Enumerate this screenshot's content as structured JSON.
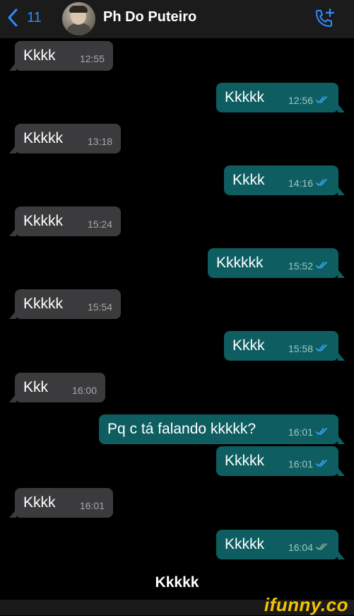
{
  "header": {
    "back_count": "11",
    "contact_name": "Ph Do Puteiro"
  },
  "messages": [
    {
      "dir": "in",
      "text": "Kkkk",
      "time": "12:55"
    },
    {
      "dir": "out",
      "text": "Kkkkk",
      "time": "12:56",
      "read": true
    },
    {
      "dir": "in",
      "text": "Kkkkk",
      "time": "13:18"
    },
    {
      "dir": "out",
      "text": "Kkkk",
      "time": "14:16",
      "read": true
    },
    {
      "dir": "in",
      "text": "Kkkkk",
      "time": "15:24"
    },
    {
      "dir": "out",
      "text": "Kkkkkk",
      "time": "15:52",
      "read": true
    },
    {
      "dir": "in",
      "text": "Kkkkk",
      "time": "15:54"
    },
    {
      "dir": "out",
      "text": "Kkkk",
      "time": "15:58",
      "read": true
    },
    {
      "dir": "in",
      "text": "Kkk",
      "time": "16:00"
    },
    {
      "dir": "out",
      "text": "Pq c tá falando kkkkk?",
      "time": "16:01",
      "read": true
    },
    {
      "dir": "out",
      "text": "Kkkkk",
      "time": "16:01",
      "read": true
    },
    {
      "dir": "in",
      "text": "Kkkk",
      "time": "16:01"
    },
    {
      "dir": "out",
      "text": "Kkkkk",
      "time": "16:04",
      "read": false
    }
  ],
  "caption": "Kkkkk",
  "watermark": "ifunny.co",
  "colors": {
    "incoming_bubble": "#3b3b3d",
    "outgoing_bubble": "#0e5e61",
    "read_ticks": "#3da6ff",
    "unread_ticks": "#9aa6a6",
    "accent": "#2f8bff",
    "watermark": "#f3c300"
  }
}
